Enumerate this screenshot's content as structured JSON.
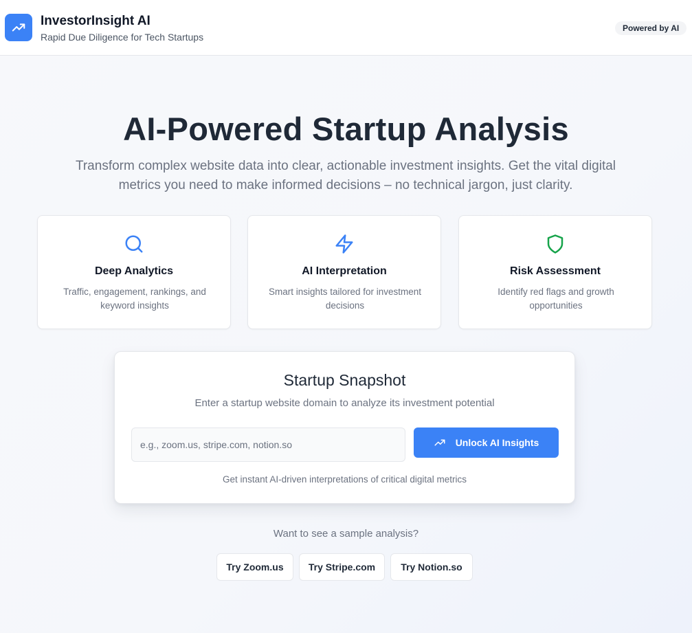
{
  "header": {
    "title": "InvestorInsight AI",
    "subtitle": "Rapid Due Diligence for Tech Startups",
    "badge": "Powered by AI"
  },
  "hero": {
    "title": "AI-Powered Startup Analysis",
    "subtitle": "Transform complex website data into clear, actionable investment insights. Get the vital digital metrics you need to make informed decisions – no technical jargon, just clarity."
  },
  "features": [
    {
      "title": "Deep Analytics",
      "description": "Traffic, engagement, rankings, and keyword insights",
      "icon": "search-icon",
      "color": "#3b82f6"
    },
    {
      "title": "AI Interpretation",
      "description": "Smart insights tailored for investment decisions",
      "icon": "lightning-icon",
      "color": "#3b82f6"
    },
    {
      "title": "Risk Assessment",
      "description": "Identify red flags and growth opportunities",
      "icon": "shield-icon",
      "color": "#16a34a"
    }
  ],
  "snapshot": {
    "title": "Startup Snapshot",
    "subtitle": "Enter a startup website domain to analyze its investment potential",
    "input_placeholder": "e.g., zoom.us, stripe.com, notion.so",
    "input_value": "",
    "button_label": "Unlock AI Insights",
    "hint": "Get instant AI-driven interpretations of critical digital metrics"
  },
  "samples": {
    "question": "Want to see a sample analysis?",
    "buttons": [
      "Try Zoom.us",
      "Try Stripe.com",
      "Try Notion.so"
    ]
  },
  "colors": {
    "accent": "#3b82f6",
    "success": "#16a34a"
  }
}
